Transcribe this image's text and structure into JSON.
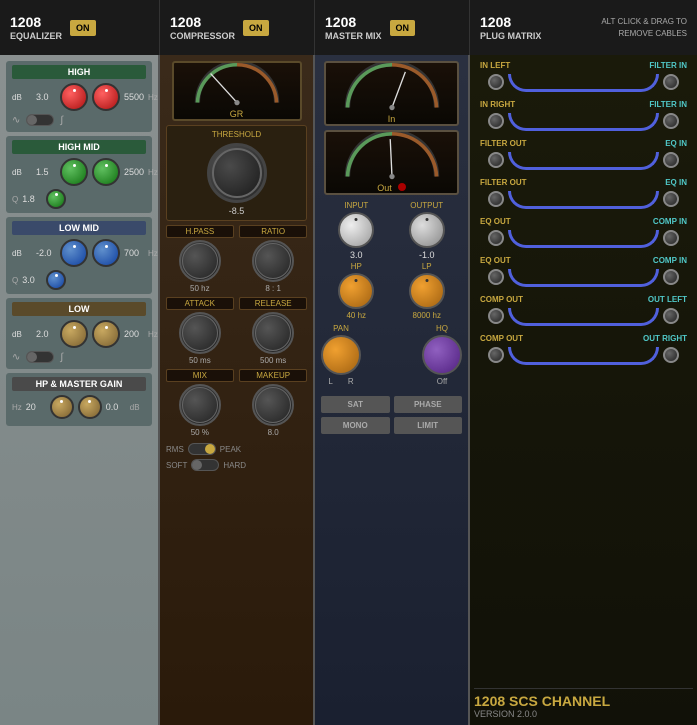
{
  "app": {
    "title": "1208 SCS Channel",
    "version": "VERSION 2.0.0"
  },
  "panels": {
    "eq": {
      "title": "1208",
      "subtitle": "EQUALIZER",
      "on_label": "ON",
      "bands": {
        "high": {
          "label": "HIGH",
          "db": "3.0",
          "freq": "5500",
          "freq_unit": "Hz",
          "db_label": "dB"
        },
        "high_mid": {
          "label": "HIGH MID",
          "db": "1.5",
          "freq": "2500",
          "freq_unit": "Hz",
          "db_label": "dB",
          "q": "1.8"
        },
        "low_mid": {
          "label": "LOW MID",
          "db": "-2.0",
          "freq": "700",
          "freq_unit": "Hz",
          "db_label": "dB",
          "q": "3.0"
        },
        "low": {
          "label": "LOW",
          "db": "2.0",
          "freq": "200",
          "freq_unit": "Hz",
          "db_label": "dB"
        },
        "hp_master": {
          "label": "HP & MASTER GAIN",
          "freq": "20",
          "freq_unit": "Hz",
          "gain": "0.0",
          "gain_unit": "dB"
        }
      }
    },
    "compressor": {
      "title": "1208",
      "subtitle": "COMPRESSOR",
      "on_label": "ON",
      "gr_label": "GR",
      "threshold_label": "THRESHOLD",
      "threshold_val": "-8.5",
      "hpass_label": "H.PASS",
      "ratio_label": "RATIO",
      "hpass_val": "50 hz",
      "ratio_val": "8 : 1",
      "attack_label": "ATTACK",
      "release_label": "RELEASE",
      "attack_val": "50 ms",
      "release_val": "500 ms",
      "mix_label": "MIX",
      "makeup_label": "MAKEUP",
      "mix_val": "50 %",
      "makeup_val": "8.0",
      "rms_label": "RMS",
      "peak_label": "PEAK",
      "soft_label": "SOFT",
      "hard_label": "HARD"
    },
    "master_mix": {
      "title": "1208",
      "subtitle": "MASTER MIX",
      "on_label": "ON",
      "in_label": "In",
      "out_label": "Out",
      "input_label": "INPUT",
      "output_label": "OUTPUT",
      "input_val": "3.0",
      "output_val": "-1.0",
      "hp_label": "HP",
      "lp_label": "LP",
      "hp_freq": "40 hz",
      "lp_freq": "8000 hz",
      "pan_label": "PAN",
      "hq_label": "HQ",
      "pan_l": "L",
      "pan_r": "R",
      "hq_val": "Off",
      "sat_label": "SAT",
      "phase_label": "PHASE",
      "mono_label": "MONO",
      "limit_label": "LIMIT"
    },
    "plug_matrix": {
      "title": "1208",
      "subtitle": "PLUG MATRIX",
      "alt_text": "ALT CLICK & DRAG TO\nREMOVE CABLES",
      "ports": [
        {
          "left": "IN LEFT",
          "right": "FILTER IN"
        },
        {
          "left": "IN RIGHT",
          "right": "FILTER IN"
        },
        {
          "left": "FILTER OUT",
          "right": "EQ IN"
        },
        {
          "left": "FILTER OUT",
          "right": "EQ IN"
        },
        {
          "left": "EQ OUT",
          "right": "COMP IN"
        },
        {
          "left": "EQ OUT",
          "right": "COMP IN"
        },
        {
          "left": "COMP OUT",
          "right": "OUT LEFT"
        },
        {
          "left": "COMP OUT",
          "right": "OUT RIGHT"
        }
      ],
      "scs_label": "1208 SCS CHANNEL"
    }
  }
}
